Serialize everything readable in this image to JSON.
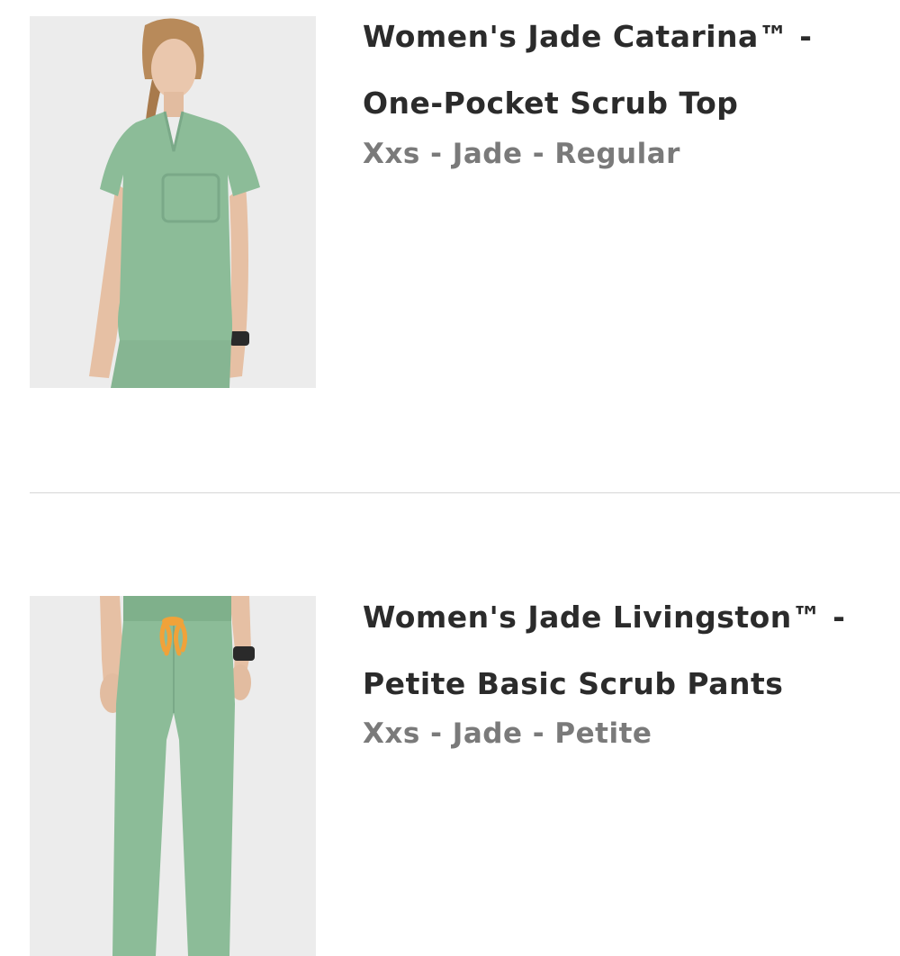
{
  "cart_items": [
    {
      "title_line1": "Women's Jade Catarina™ -",
      "title_line2": "One-Pocket Scrub Top",
      "variant": "Xxs - Jade - Regular",
      "image_alt": "Model wearing jade one-pocket scrub top"
    },
    {
      "title_line1": "Women's Jade Livingston™ -",
      "title_line2": "Petite Basic Scrub Pants",
      "variant": "Xxs - Jade - Petite",
      "image_alt": "Model wearing jade petite scrub pants"
    }
  ],
  "colors": {
    "jade": "#8cbc98",
    "drawstring": "#f0a23a",
    "image_bg": "#ececec",
    "title_text": "#2b2b2b",
    "variant_text": "#7a7a7a",
    "divider": "#d6d6d6"
  }
}
